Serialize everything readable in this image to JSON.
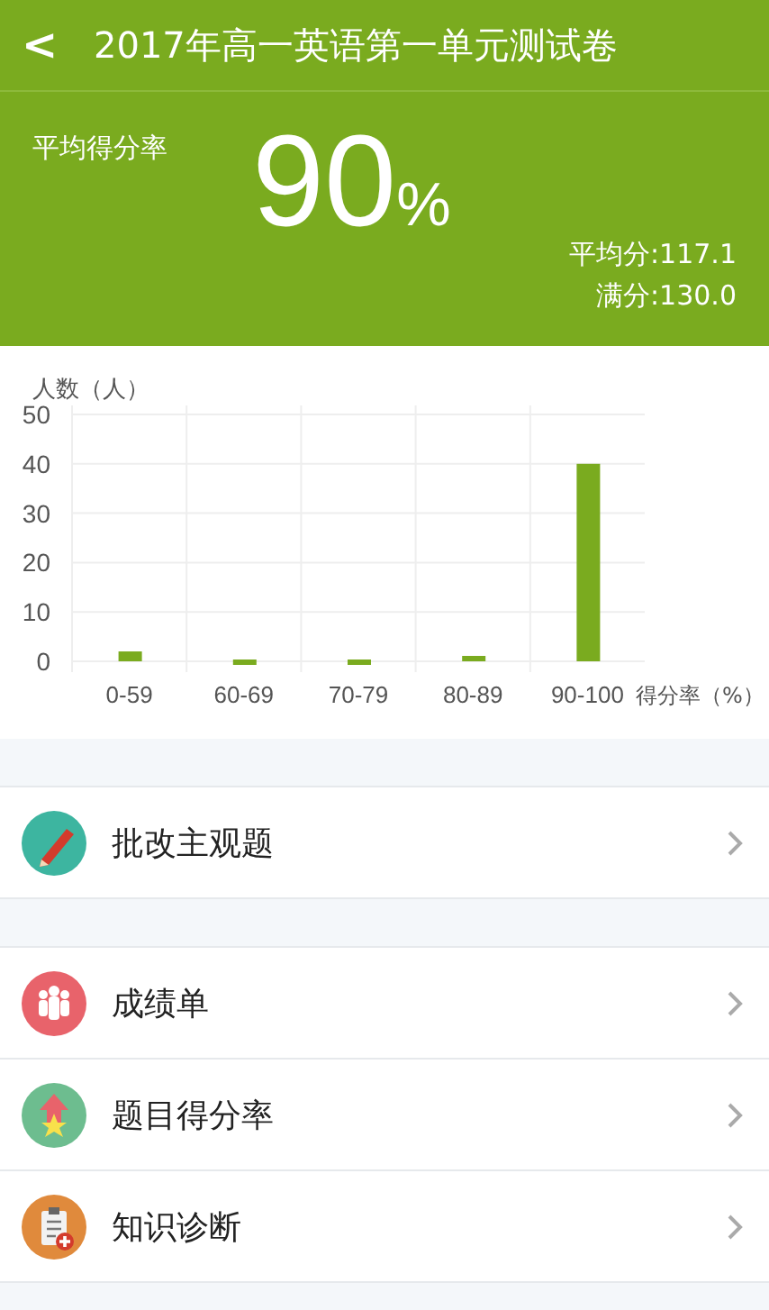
{
  "header": {
    "back": "<",
    "title": "2017年高一英语第一单元测试卷"
  },
  "summary": {
    "label": "平均得分率",
    "value": "90",
    "unit": "%",
    "average": "平均分:117.1",
    "full": "满分:130.0"
  },
  "chart_data": {
    "type": "bar",
    "ylabel": "人数（人）",
    "xlabel": "得分率（%）",
    "categories": [
      "0-59",
      "60-69",
      "70-79",
      "80-89",
      "90-100"
    ],
    "values": [
      2,
      0,
      0,
      1,
      40
    ],
    "ylim": [
      0,
      50
    ],
    "grid": true,
    "yticks": [
      0,
      10,
      20,
      30,
      40,
      50
    ]
  },
  "groups": [
    [
      {
        "label": "批改主观题",
        "kind": "pencil",
        "color": "#3db5a0"
      }
    ],
    [
      {
        "label": "成绩单",
        "kind": "people",
        "color": "#e8636b"
      },
      {
        "label": "题目得分率",
        "kind": "star",
        "color": "#6dbd8f"
      },
      {
        "label": "知识诊断",
        "kind": "clipboard",
        "color": "#e08a3c"
      }
    ]
  ]
}
